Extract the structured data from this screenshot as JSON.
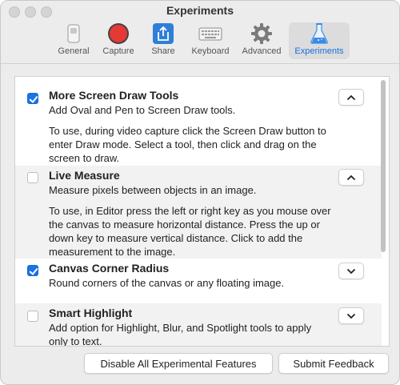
{
  "window": {
    "title": "Experiments"
  },
  "toolbar": {
    "tabs": [
      {
        "label": "General",
        "icon": "general-icon"
      },
      {
        "label": "Capture",
        "icon": "record-icon"
      },
      {
        "label": "Share",
        "icon": "share-icon"
      },
      {
        "label": "Keyboard",
        "icon": "keyboard-icon"
      },
      {
        "label": "Advanced",
        "icon": "gear-icon"
      },
      {
        "label": "Experiments",
        "icon": "flask-icon",
        "selected": true
      }
    ]
  },
  "experiments": [
    {
      "title": "More Screen Draw Tools",
      "checked": true,
      "expanded": true,
      "summary": "Add Oval and Pen to Screen Draw tools.",
      "details": "To use, during video capture click the Screen Draw button to enter Draw mode. Select a tool, then click and drag on the screen to draw."
    },
    {
      "title": "Live Measure",
      "checked": false,
      "expanded": true,
      "summary": "Measure pixels between objects in an image.",
      "details": "To use, in Editor press the left or right key as you mouse over the canvas to measure horizontal distance. Press the up or down key to measure vertical distance. Click to add the measurement to the image."
    },
    {
      "title": "Canvas Corner Radius",
      "checked": true,
      "expanded": false,
      "summary": "Round corners of the canvas or any floating image."
    },
    {
      "title": "Smart Highlight",
      "checked": false,
      "expanded": false,
      "summary": "Add option for Highlight, Blur, and Spotlight tools to apply only to text."
    }
  ],
  "footer": {
    "disable_label": "Disable All Experimental Features",
    "feedback_label": "Submit Feedback"
  },
  "colors": {
    "accent": "#1a73e8",
    "capture_red": "#e53935",
    "share_blue": "#2f7fd9"
  }
}
